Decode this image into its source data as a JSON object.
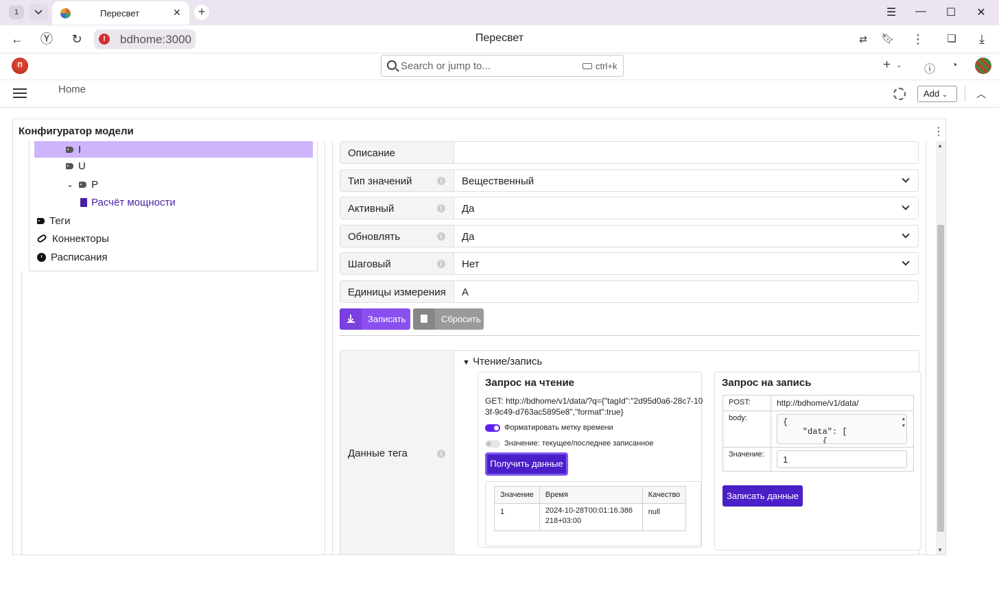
{
  "browser": {
    "tab_count": "1",
    "tab_title": "Пересвет",
    "url": "bdhome:3000",
    "page_title": "Пересвет"
  },
  "app": {
    "logo_text": "П",
    "search_placeholder": "Search or jump to...",
    "search_shortcut": "ctrl+k",
    "breadcrumb_home": "Home",
    "add_label": "Add"
  },
  "panel": {
    "title": "Конфигуратор модели"
  },
  "tree": {
    "items": [
      {
        "label": "I"
      },
      {
        "label": "U"
      },
      {
        "label": "P"
      },
      {
        "label": "Расчёт мощности"
      },
      {
        "label": "Теги"
      },
      {
        "label": "Коннекторы"
      },
      {
        "label": "Расписания"
      }
    ]
  },
  "form": {
    "rows": [
      {
        "label": "Описание",
        "value": ""
      },
      {
        "label": "Тип значений",
        "value": "Вещественный"
      },
      {
        "label": "Активный",
        "value": "Да"
      },
      {
        "label": "Обновлять",
        "value": "Да"
      },
      {
        "label": "Шаговый",
        "value": "Нет"
      },
      {
        "label": "Единицы измерения",
        "value": "А"
      }
    ],
    "save_label": "Записать",
    "reset_label": "Сбросить"
  },
  "tag_data": {
    "label": "Данные тега",
    "summary": "Чтение/запись",
    "read": {
      "title": "Запрос на чтение",
      "get_text": "GET:  http://bdhome/v1/data/?q={\"tagId\":\"2d95d0a6-28c7-103f-9c49-d763ac5895e8\",\"format\":true}",
      "toggle_format": "Форматировать метку времени",
      "toggle_value": "Значение: текущее/последнее записанное",
      "get_button": "Получить данные",
      "columns": [
        "Значение",
        "Время",
        "Качество"
      ],
      "rows": [
        {
          "value": "1",
          "time": "2024-10-28T00:01:16.386218+03:00",
          "quality": "null"
        }
      ]
    },
    "write": {
      "title": "Запрос на запись",
      "post_label": "POST:",
      "post_url": "http://bdhome/v1/data/",
      "body_label": "body:",
      "body_text": "{\n    \"data\": [\n        {",
      "value_label": "Значение:",
      "value": "1",
      "write_button": "Записать данные"
    }
  }
}
